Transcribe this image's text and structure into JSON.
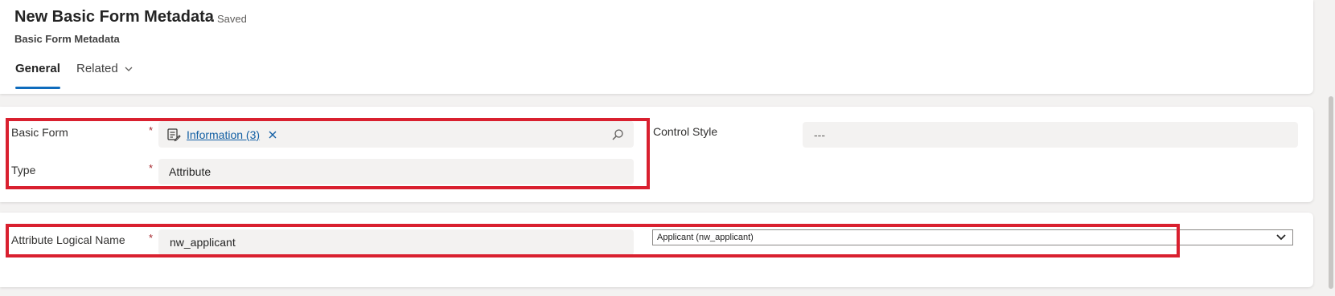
{
  "header": {
    "title": "New Basic Form Metadata",
    "status": "- Saved",
    "subtitle": "Basic Form Metadata",
    "tabs": [
      {
        "label": "General",
        "selected": true
      },
      {
        "label": "Related",
        "selected": false
      }
    ]
  },
  "section1": {
    "basic_form": {
      "label": "Basic Form",
      "required_marker": "*",
      "lookup_value": "Information (3)",
      "icon": "form-entity-icon"
    },
    "type": {
      "label": "Type",
      "required_marker": "*",
      "value": "Attribute"
    },
    "control_style": {
      "label": "Control Style",
      "value": "---"
    }
  },
  "section2": {
    "attribute_logical_name": {
      "label": "Attribute Logical Name",
      "required_marker": "*",
      "value": "nw_applicant"
    },
    "attribute_select": {
      "selected": "Applicant (nw_applicant)"
    }
  },
  "colors": {
    "accent": "#0f6cbd",
    "highlight": "#d9202f",
    "required": "#a4262c",
    "link": "#115ea3"
  }
}
